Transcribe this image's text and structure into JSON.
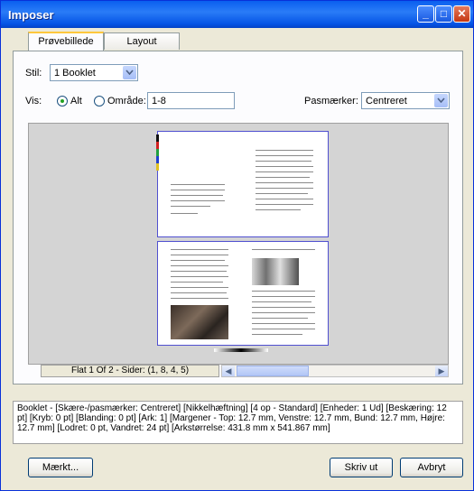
{
  "window": {
    "title": "Imposer"
  },
  "tabs": [
    {
      "label": "Prøvebillede"
    },
    {
      "label": "Layout"
    }
  ],
  "style": {
    "label": "Stil:",
    "value": "1 Booklet"
  },
  "view": {
    "label": "Vis:",
    "all_label": "Alt",
    "range_label": "Område:",
    "range_value": "1-8",
    "selected": "all"
  },
  "marks": {
    "label": "Pasmærker:",
    "value": "Centreret"
  },
  "status": {
    "sheet_text": "Flat 1 Of 2 - Sider: (1, 8, 4, 5)"
  },
  "info": {
    "text": "Booklet - [Skære-/pasmærker: Centreret] [Nikkelhæftning] [4 op - Standard] [Enheder: 1 Ud] [Beskæring: 12 pt] [Kryb: 0 pt] [Blanding: 0 pt] [Ark: 1] [Margener - Top: 12.7 mm, Venstre: 12.7 mm, Bund: 12.7 mm, Højre: 12.7 mm] [Lodret: 0 pt, Vandret: 24 pt] [Arkstørrelse: 431.8 mm x 541.867 mm]"
  },
  "buttons": {
    "marks": "Mærkt...",
    "print": "Skriv ut",
    "cancel": "Avbryt"
  },
  "colors": {
    "titlebar": "#0a5fef",
    "accent": "#ffc83c",
    "preview_bg": "#d4d4d4"
  }
}
